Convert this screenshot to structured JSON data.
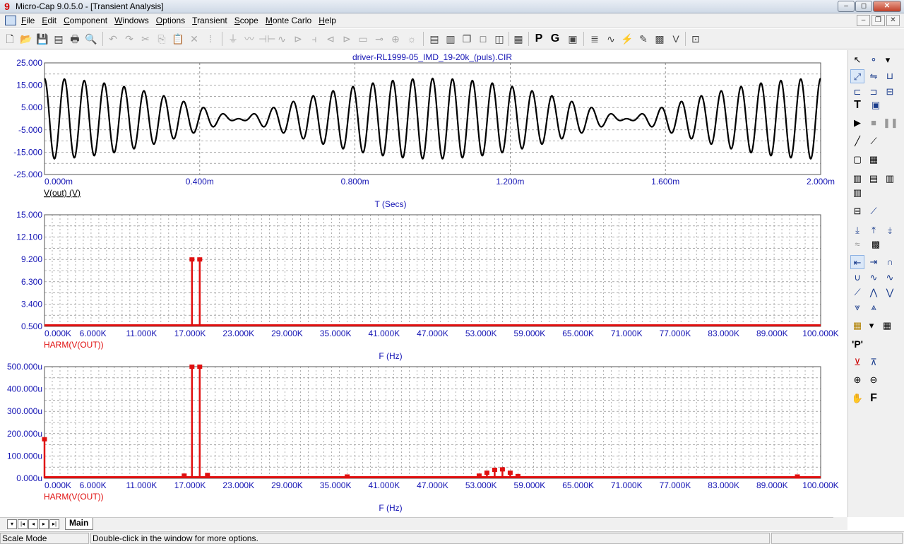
{
  "window": {
    "title": "Micro-Cap 9.0.5.0 - [Transient Analysis]",
    "min_label": "–",
    "max_label": "◻",
    "close_label": "✕"
  },
  "menu": [
    "File",
    "Edit",
    "Component",
    "Windows",
    "Options",
    "Transient",
    "Scope",
    "Monte Carlo",
    "Help"
  ],
  "mdi": {
    "min_label": "–",
    "restore_label": "❐",
    "close_label": "✕"
  },
  "toolbar_letters": {
    "p": "P",
    "g": "G"
  },
  "palette_letters": {
    "text_tool": "T",
    "p_tool": "'P'",
    "f_tool": "F"
  },
  "plot": {
    "circuit_title": "driver-RL1999-05_IMD_19-20k_(puls).CIR",
    "colors": {
      "grid": "#7a7a7a",
      "axis_text": "#1414b4",
      "trace_time": "#000000",
      "trace_harm": "#e01010"
    }
  },
  "chart_data": [
    {
      "type": "line",
      "id": "time-domain",
      "xlabel": "T (Secs)",
      "trace_label": "V(out) (V)",
      "xlim": [
        0,
        0.002
      ],
      "ylim": [
        -25,
        25
      ],
      "x_ticks": [
        "0.000m",
        "0.400m",
        "0.800m",
        "1.200m",
        "1.600m",
        "2.000m"
      ],
      "y_ticks": [
        "25.000",
        "15.000",
        "5.000",
        "-5.000",
        "-15.000",
        "-25.000"
      ],
      "signal": {
        "components_hz": [
          19000,
          20000
        ],
        "amplitude_each": 9,
        "peak": 18
      }
    },
    {
      "type": "bar",
      "id": "spectrum-linear",
      "xlabel": "F (Hz)",
      "trace_label": "HARM(V(OUT))",
      "xlim": [
        0,
        100000
      ],
      "ylim": [
        0.5,
        15
      ],
      "x_ticks": [
        "0.000K",
        "6.000K",
        "11.000K",
        "17.000K",
        "23.000K",
        "29.000K",
        "35.000K",
        "41.000K",
        "47.000K",
        "53.000K",
        "59.000K",
        "65.000K",
        "71.000K",
        "77.000K",
        "83.000K",
        "89.000K",
        "100.000K"
      ],
      "y_ticks": [
        "15.000",
        "12.100",
        "9.200",
        "6.300",
        "3.400",
        "0.500"
      ],
      "x": [
        19000,
        20000
      ],
      "values": [
        9.2,
        9.2
      ]
    },
    {
      "type": "bar",
      "id": "spectrum-detail",
      "xlabel": "F (Hz)",
      "trace_label": "HARM(V(OUT))",
      "xlim": [
        0,
        100000
      ],
      "ylim": [
        0,
        0.0005
      ],
      "x_ticks": [
        "0.000K",
        "6.000K",
        "11.000K",
        "17.000K",
        "23.000K",
        "29.000K",
        "35.000K",
        "41.000K",
        "47.000K",
        "53.000K",
        "59.000K",
        "65.000K",
        "71.000K",
        "77.000K",
        "83.000K",
        "89.000K",
        "100.000K"
      ],
      "y_ticks": [
        "500.000u",
        "400.000u",
        "300.000u",
        "200.000u",
        "100.000u",
        "0.000u"
      ],
      "x": [
        0,
        18000,
        19000,
        20000,
        21000,
        39000,
        56000,
        57000,
        58000,
        59000,
        60000,
        61000,
        97000
      ],
      "values": [
        0.000175,
        1.2e-05,
        0.0005,
        0.0005,
        1.5e-05,
        8e-06,
        1.2e-05,
        2.5e-05,
        3.8e-05,
        4e-05,
        2.5e-05,
        1e-05,
        8e-06
      ]
    }
  ],
  "tabs": {
    "main_label": "Main"
  },
  "status": {
    "mode": "Scale Mode",
    "hint": "Double-click in the window for more options."
  }
}
